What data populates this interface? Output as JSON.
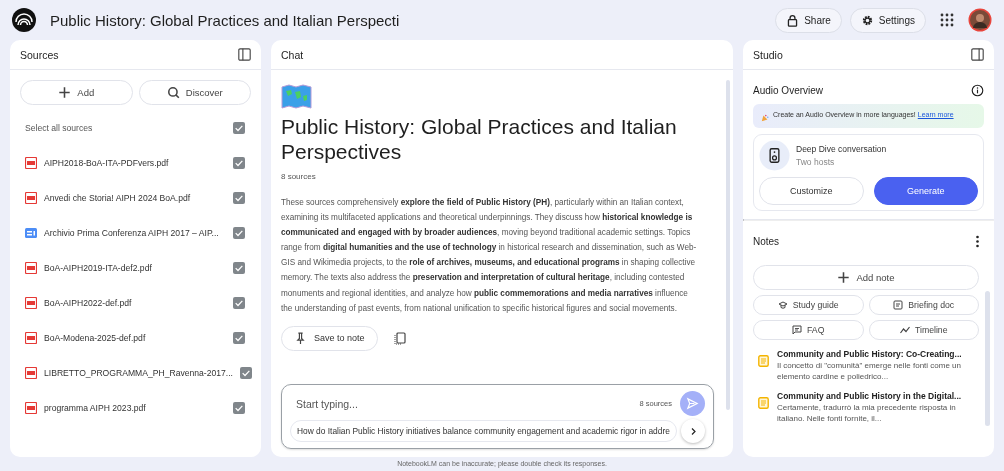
{
  "header": {
    "title": "Public History: Global Practices and Italian Perspecti",
    "share": "Share",
    "settings": "Settings"
  },
  "sources": {
    "title": "Sources",
    "add": "Add",
    "discover": "Discover",
    "select_all": {
      "label": "Select all sources",
      "checked": true
    },
    "items": [
      {
        "kind": "pdf",
        "name": "AIPH2018-BoA-ITA-PDFvers.pdf",
        "checked": true
      },
      {
        "kind": "pdf",
        "name": "Anvedi che Storia! AIPH 2024 BoA.pdf",
        "checked": true
      },
      {
        "kind": "doc",
        "name": "Archivio Prima Conferenza AIPH 2017 – AIP...",
        "checked": true
      },
      {
        "kind": "pdf",
        "name": "BoA-AIPH2019-ITA-def2.pdf",
        "checked": true
      },
      {
        "kind": "pdf",
        "name": "BoA-AIPH2022-def.pdf",
        "checked": true
      },
      {
        "kind": "pdf",
        "name": "BoA-Modena-2025-def.pdf",
        "checked": true
      },
      {
        "kind": "pdf",
        "name": "LIBRETTO_PROGRAMMA_PH_Ravenna-2017...",
        "checked": true
      },
      {
        "kind": "pdf",
        "name": "programma AIPH 2023.pdf",
        "checked": true
      }
    ]
  },
  "chat": {
    "title": "Chat",
    "notebook_title": "Public History: Global Practices and Italian Perspectives",
    "source_count": "8 sources",
    "summary": "These sources comprehensively **explore the field of Public History (PH)**, particularly within an Italian context, examining its multifaceted applications and theoretical underpinnings. They discuss how **historical knowledge is communicated and engaged with by broader audiences**, moving beyond traditional academic settings. Topics range from **digital humanities and the use of technology** in historical research and dissemination, such as Web-GIS and Wikimedia projects, to the **role of archives, museums, and educational programs** in shaping collective memory. The texts also address the **preservation and interpretation of cultural heritage**, including contested monuments and regional identities, and analyze how **public commemorations and media narratives** influence the understanding of past events, from national unification to specific historical figures and social movements.",
    "save_to_note": "Save to note",
    "input": {
      "placeholder": "Start typing...",
      "source_count": "8 sources"
    },
    "suggestion": "How do Italian Public History initiatives balance community engagement and academic rigor in addre"
  },
  "studio": {
    "title": "Studio",
    "audio_overview": {
      "title": "Audio Overview",
      "banner": "Create an Audio Overview in more languages!",
      "banner_link": "Learn more",
      "card_title": "Deep Dive conversation",
      "card_subtitle": "Two hosts",
      "customize": "Customize",
      "generate": "Generate"
    },
    "notes": {
      "title": "Notes",
      "add_note": "Add note",
      "tools": [
        {
          "kind": "study",
          "label": "Study guide"
        },
        {
          "kind": "briefing",
          "label": "Briefing doc"
        },
        {
          "kind": "faq",
          "label": "FAQ"
        },
        {
          "kind": "timeline",
          "label": "Timeline"
        }
      ],
      "items": [
        {
          "title": "Community and Public History: Co-Creating...",
          "preview": "Il concetto di \"comunità\" emerge nelle fonti come un elemento cardine e poliedrico..."
        },
        {
          "title": "Community and Public History in the Digital...",
          "preview": "Certamente, tradurrò la mia precedente risposta in italiano. Nelle fonti fornite, il..."
        }
      ]
    }
  },
  "footer": "NotebookLM can be inaccurate; please double check its responses."
}
